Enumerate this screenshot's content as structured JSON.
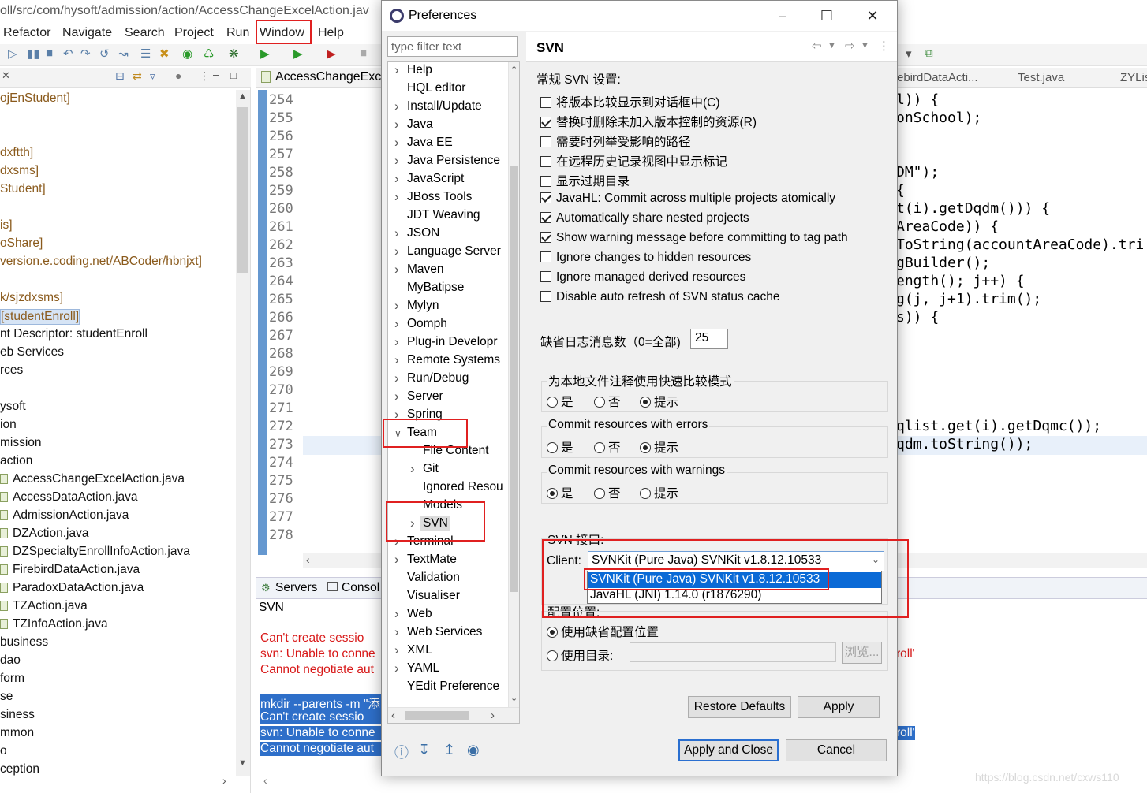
{
  "colors": {
    "highlight_red": "#e02020",
    "selection_blue": "#0a6ad6",
    "console_error": "#d81818"
  },
  "eclipse": {
    "title": "oll/src/com/hysoft/admission/action/AccessChangeExcelAction.jav",
    "menu": [
      "Refactor",
      "Navigate",
      "Search",
      "Project",
      "Run",
      "Window",
      "Help"
    ],
    "explorer_lines": [
      {
        "t": "ojEnStudent]",
        "c": "brown"
      },
      {
        "t": "",
        "c": "black"
      },
      {
        "t": "",
        "c": "black"
      },
      {
        "t": "dxftth]",
        "c": "brown"
      },
      {
        "t": "dxsms]",
        "c": "brown"
      },
      {
        "t": "Student]",
        "c": "brown"
      },
      {
        "t": "",
        "c": "black"
      },
      {
        "t": "is]",
        "c": "brown"
      },
      {
        "t": "oShare]",
        "c": "brown"
      },
      {
        "t": "version.e.coding.net/ABCoder/hbnjxt]",
        "c": "brown"
      },
      {
        "t": "",
        "c": "black"
      },
      {
        "t": "k/sjzdxsms]",
        "c": "brown"
      },
      {
        "t": "[studentEnroll]",
        "c": "brown",
        "sel": true
      },
      {
        "t": "nt Descriptor: studentEnroll",
        "c": "black"
      },
      {
        "t": "eb Services",
        "c": "black"
      },
      {
        "t": "rces",
        "c": "black"
      },
      {
        "t": "",
        "c": "black"
      },
      {
        "t": "ysoft",
        "c": "black"
      },
      {
        "t": "ion",
        "c": "black"
      },
      {
        "t": "mission",
        "c": "black"
      },
      {
        "t": "action",
        "c": "black"
      },
      {
        "t": "AccessChangeExcelAction.java",
        "c": "black",
        "file": true
      },
      {
        "t": "AccessDataAction.java",
        "c": "black",
        "file": true
      },
      {
        "t": "AdmissionAction.java",
        "c": "black",
        "file": true
      },
      {
        "t": "DZAction.java",
        "c": "black",
        "file": true
      },
      {
        "t": "DZSpecialtyEnrollInfoAction.java",
        "c": "black",
        "file": true
      },
      {
        "t": "FirebirdDataAction.java",
        "c": "black",
        "file": true
      },
      {
        "t": "ParadoxDataAction.java",
        "c": "black",
        "file": true
      },
      {
        "t": "TZAction.java",
        "c": "black",
        "file": true
      },
      {
        "t": "TZInfoAction.java",
        "c": "black",
        "file": true
      },
      {
        "t": "business",
        "c": "black"
      },
      {
        "t": "dao",
        "c": "black"
      },
      {
        "t": "form",
        "c": "black"
      },
      {
        "t": "se",
        "c": "black"
      },
      {
        "t": "siness",
        "c": "black"
      },
      {
        "t": "mmon",
        "c": "black"
      },
      {
        "t": "o",
        "c": "black"
      },
      {
        "t": "ception",
        "c": "black"
      }
    ],
    "editor_tab": "AccessChangeExce",
    "editor_tabs_right": [
      "ebirdDataActi...",
      "Test.java",
      "ZYLis"
    ],
    "line_numbers": [
      "254",
      "255",
      "256",
      "257",
      "258",
      "259",
      "260",
      "261",
      "262",
      "263",
      "264",
      "265",
      "266",
      "267",
      "268",
      "269",
      "270",
      "271",
      "272",
      "273",
      "274",
      "275",
      "276",
      "277",
      "278"
    ],
    "code_right": [
      {
        "row": 0,
        "t": "l)) {"
      },
      {
        "row": 1,
        "t": "onSchool);"
      },
      {
        "row": 4,
        "t": "DM\");"
      },
      {
        "row": 5,
        "t": "{"
      },
      {
        "row": 6,
        "t": "t(i).getDqdm())) {"
      },
      {
        "row": 7,
        "t": "AreaCode)) {"
      },
      {
        "row": 8,
        "t": "ToString(accountAreaCode).tri"
      },
      {
        "row": 9,
        "t": "gBuilder();"
      },
      {
        "row": 10,
        "t": "ength(); j++) {"
      },
      {
        "row": 11,
        "t": "g(j, j+1).trim();"
      },
      {
        "row": 12,
        "t": "s)) {"
      },
      {
        "row": 18,
        "t": "qlist.get(i).getDqmc());"
      },
      {
        "row": 19,
        "t": "qdm.toString());"
      }
    ],
    "console_tabs": [
      "Servers",
      "Consol"
    ],
    "console_title": "SVN",
    "console_lines": [
      {
        "t": "  Can't create sessio",
        "c": "red"
      },
      {
        "t": "svn: Unable to conne",
        "c": "red"
      },
      {
        "t": "Cannot negotiate aut",
        "c": "red"
      },
      {
        "t": "",
        "c": "red"
      },
      {
        "t": "mkdir --parents -m \"添",
        "c": "sel"
      },
      {
        "t": "  Can't create sessio",
        "c": "sel"
      },
      {
        "t": "svn: Unable to conne",
        "c": "sel"
      },
      {
        "t": "Cannot negotiate aut",
        "c": "sel"
      }
    ],
    "console_right": [
      {
        "row": 1,
        "t": "roll'",
        "c": "red"
      },
      {
        "row": 6,
        "t": "roll'",
        "c": "sel"
      }
    ],
    "watermark": "https://blog.csdn.net/cxws110"
  },
  "dialog": {
    "title": "Preferences",
    "filter_placeholder": "type filter text",
    "tree": [
      {
        "label": "Help",
        "arrow": "right",
        "indent": 0
      },
      {
        "label": "HQL editor",
        "arrow": "",
        "indent": 0
      },
      {
        "label": "Install/Update",
        "arrow": "right",
        "indent": 0
      },
      {
        "label": "Java",
        "arrow": "right",
        "indent": 0
      },
      {
        "label": "Java EE",
        "arrow": "right",
        "indent": 0
      },
      {
        "label": "Java Persistence",
        "arrow": "right",
        "indent": 0
      },
      {
        "label": "JavaScript",
        "arrow": "right",
        "indent": 0
      },
      {
        "label": "JBoss Tools",
        "arrow": "right",
        "indent": 0
      },
      {
        "label": "JDT Weaving",
        "arrow": "",
        "indent": 0
      },
      {
        "label": "JSON",
        "arrow": "right",
        "indent": 0
      },
      {
        "label": "Language Server",
        "arrow": "right",
        "indent": 0
      },
      {
        "label": "Maven",
        "arrow": "right",
        "indent": 0
      },
      {
        "label": "MyBatipse",
        "arrow": "",
        "indent": 0
      },
      {
        "label": "Mylyn",
        "arrow": "right",
        "indent": 0
      },
      {
        "label": "Oomph",
        "arrow": "right",
        "indent": 0
      },
      {
        "label": "Plug-in Developr",
        "arrow": "right",
        "indent": 0
      },
      {
        "label": "Remote Systems",
        "arrow": "right",
        "indent": 0
      },
      {
        "label": "Run/Debug",
        "arrow": "right",
        "indent": 0
      },
      {
        "label": "Server",
        "arrow": "right",
        "indent": 0
      },
      {
        "label": "Spring",
        "arrow": "right",
        "indent": 0
      },
      {
        "label": "Team",
        "arrow": "down",
        "indent": 0
      },
      {
        "label": "File Content",
        "arrow": "",
        "indent": 1
      },
      {
        "label": "Git",
        "arrow": "right",
        "indent": 1
      },
      {
        "label": "Ignored Resou",
        "arrow": "",
        "indent": 1
      },
      {
        "label": "Models",
        "arrow": "",
        "indent": 1
      },
      {
        "label": "SVN",
        "arrow": "right",
        "indent": 1,
        "selected": true
      },
      {
        "label": "Terminal",
        "arrow": "right",
        "indent": 0
      },
      {
        "label": "TextMate",
        "arrow": "right",
        "indent": 0
      },
      {
        "label": "Validation",
        "arrow": "",
        "indent": 0
      },
      {
        "label": "Visualiser",
        "arrow": "",
        "indent": 0
      },
      {
        "label": "Web",
        "arrow": "right",
        "indent": 0
      },
      {
        "label": "Web Services",
        "arrow": "right",
        "indent": 0
      },
      {
        "label": "XML",
        "arrow": "right",
        "indent": 0
      },
      {
        "label": "YAML",
        "arrow": "right",
        "indent": 0
      },
      {
        "label": "YEdit Preference",
        "arrow": "",
        "indent": 0
      }
    ],
    "pane_title": "SVN",
    "section_general": "常规 SVN 设置:",
    "checkboxes": [
      {
        "label": "将版本比较显示到对话框中(C)",
        "checked": false
      },
      {
        "label": "替换时删除未加入版本控制的资源(R)",
        "checked": true
      },
      {
        "label": "需要时列举受影响的路径",
        "checked": false
      },
      {
        "label": "在远程历史记录视图中显示标记",
        "checked": false
      },
      {
        "label": "显示过期目录",
        "checked": false
      },
      {
        "label": "JavaHL: Commit across multiple projects atomically",
        "checked": true
      },
      {
        "label": "Automatically share nested projects",
        "checked": true
      },
      {
        "label": "Show warning message before committing to tag path",
        "checked": true
      },
      {
        "label": "Ignore changes to hidden resources",
        "checked": false
      },
      {
        "label": "Ignore managed derived resources",
        "checked": false
      },
      {
        "label": "Disable auto refresh of SVN status cache",
        "checked": false
      }
    ],
    "log_count_label": "缺省日志消息数（0=全部)",
    "log_count_value": "25",
    "radio_groups": [
      {
        "label": "为本地文件注释使用快速比较模式",
        "options": [
          "是",
          "否",
          "提示"
        ],
        "selected": 2
      },
      {
        "label": "Commit resources with errors",
        "options": [
          "是",
          "否",
          "提示"
        ],
        "selected": 2
      },
      {
        "label": "Commit resources with warnings",
        "options": [
          "是",
          "否",
          "提示"
        ],
        "selected": 0
      }
    ],
    "svn_interface_label": "SVN 接口:",
    "client_label": "Client:",
    "client_value": "SVNKit (Pure Java) SVNKit v1.8.12.10533",
    "client_options": [
      "SVNKit (Pure Java) SVNKit v1.8.12.10533",
      "JavaHL (JNI) 1.14.0 (r1876290)"
    ],
    "config_label": "配置位置:",
    "config_default": "使用缺省配置位置",
    "config_dir": "使用目录:",
    "browse": "浏览...",
    "restore_defaults": "Restore Defaults",
    "apply": "Apply",
    "apply_close": "Apply and Close",
    "cancel": "Cancel"
  }
}
